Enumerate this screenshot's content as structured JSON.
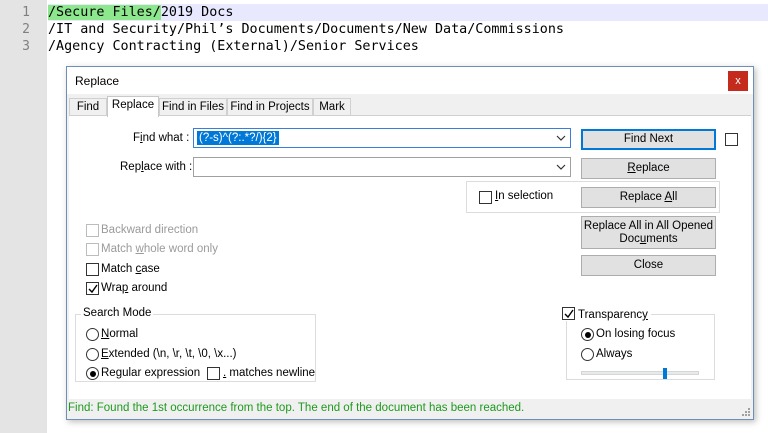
{
  "editor": {
    "lines": [
      {
        "num": "1",
        "match": "/Secure Files/",
        "rest": "2019 Docs"
      },
      {
        "num": "2",
        "text": "/IT and Security/Phil’s Documents/Documents/New Data/Commissions"
      },
      {
        "num": "3",
        "text": "/Agency Contracting (External)/Senior Services"
      }
    ],
    "colors": {
      "match_highlight": "#8de88d",
      "current_line": "#e8e8ff",
      "gutter": "#e4e4e4"
    }
  },
  "dialog": {
    "title": "Replace",
    "close_glyph": "x",
    "tabs": [
      {
        "label": "Find"
      },
      {
        "label": "Replace"
      },
      {
        "label": "Find in Files"
      },
      {
        "label": "Find in Projects"
      },
      {
        "label": "Mark"
      }
    ],
    "active_tab": "Replace",
    "find_what": {
      "label_pre": "F",
      "label_ul": "i",
      "label_post": "nd what :",
      "value": "(?-s)^(?:.*?/){2}"
    },
    "replace_with": {
      "label_pre": "Rep",
      "label_ul": "l",
      "label_post": "ace with :",
      "value": ""
    },
    "buttons": {
      "find_next": "Find Next",
      "replace_pre": "",
      "replace_ul": "R",
      "replace_post": "eplace",
      "replace_all_pre": "Replace ",
      "replace_all_ul": "A",
      "replace_all_post": "ll",
      "replace_all_opened_line1": "Replace All in All Opened",
      "replace_all_opened_line2_pre": "Doc",
      "replace_all_opened_line2_ul": "u",
      "replace_all_opened_line2_post": "ments",
      "close": "Close"
    },
    "in_selection": {
      "pre": "",
      "ul": "I",
      "post": "n selection",
      "checked": false
    },
    "options": {
      "backward": {
        "label": "Backward direction",
        "checked": false,
        "enabled": false
      },
      "whole_word": {
        "pre": "Match ",
        "ul": "w",
        "post": "hole word only",
        "checked": false,
        "enabled": false
      },
      "match_case": {
        "pre": "Match ",
        "ul": "c",
        "post": "ase",
        "checked": false,
        "enabled": true
      },
      "wrap_around": {
        "pre": "Wra",
        "ul": "p",
        "post": " around",
        "checked": true,
        "enabled": true
      }
    },
    "search_mode": {
      "title": "Search Mode",
      "normal": {
        "pre": "",
        "ul": "N",
        "post": "ormal",
        "checked": false
      },
      "extended": {
        "pre": "",
        "ul": "E",
        "post": "xtended (\\n, \\r, \\t, \\0, \\x...)",
        "checked": false
      },
      "regex": {
        "pre": "Re",
        "ul": "g",
        "post": "ular expression",
        "checked": true
      },
      "matches_newline": {
        "pre": "",
        "ul": ".",
        "post": " matches newline",
        "checked": false
      }
    },
    "transparency": {
      "pre": "Transparenc",
      "ul": "y",
      "post": "",
      "checked": true,
      "on_losing_focus": {
        "label": "On losing focus",
        "checked": true
      },
      "always": {
        "label": "Always",
        "checked": false
      },
      "slider_fraction": 0.71
    },
    "status": "Find: Found the 1st occurrence from the top. The end of the document has been reached.",
    "colors": {
      "status_text": "#1e9a1e",
      "close_button": "#c42b1c",
      "selection": "#0078d7"
    }
  }
}
